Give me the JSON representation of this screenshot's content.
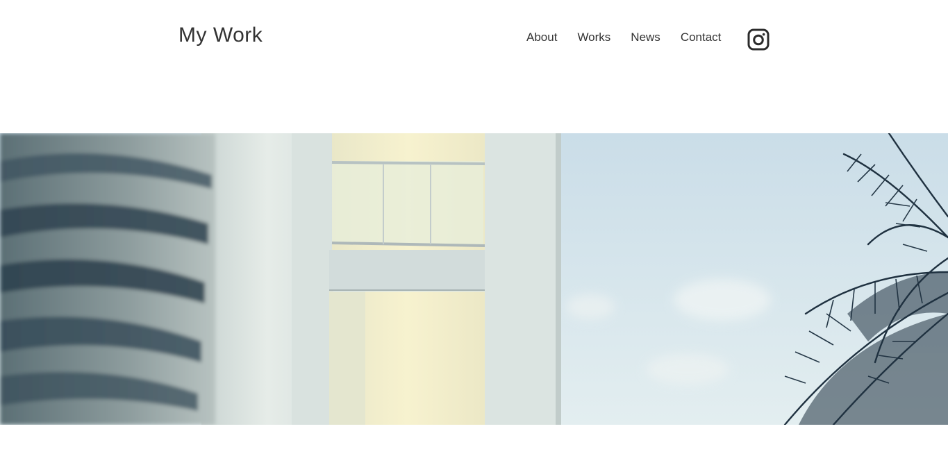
{
  "site": {
    "title": "My Work"
  },
  "nav": {
    "items": [
      {
        "label": "About"
      },
      {
        "label": "Works"
      },
      {
        "label": "News"
      },
      {
        "label": "Contact"
      }
    ],
    "social_icon": "instagram-icon"
  },
  "hero": {
    "image_subject": "hero-photo",
    "colors": {
      "sky": "#d4e4ec",
      "wall": "#dfe8e6",
      "warm_light": "#f4efc8",
      "palm_dark": "#1f3140"
    }
  }
}
